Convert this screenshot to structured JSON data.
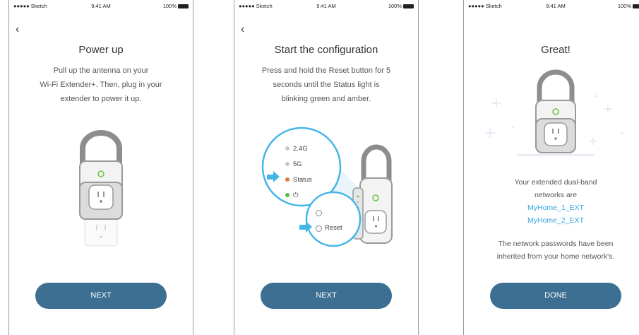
{
  "status_bar": {
    "carrier": "●●●●● Sketch",
    "time": "9:41 AM",
    "battery": "100%"
  },
  "screen1": {
    "back_icon": "‹",
    "title": "Power up",
    "description": [
      "Pull up the antenna on your",
      "Wi-Fi Extender+. Then, plug in your",
      "extender to power it up."
    ],
    "button": "NEXT"
  },
  "screen2": {
    "back_icon": "‹",
    "title": "Start the configuration",
    "description": [
      "Press and hold the Reset button for 5",
      "seconds until the Status light is",
      "blinking green and amber."
    ],
    "leds": [
      {
        "label": "2.4G",
        "color": "#c8c8c8"
      },
      {
        "label": "5G",
        "color": "#c8c8c8"
      },
      {
        "label": "Status",
        "color": "#e07a3a"
      },
      {
        "label": "⏻",
        "color": "#5dbb3a"
      }
    ],
    "reset_label": "Reset",
    "button": "NEXT"
  },
  "screen3": {
    "title": "Great!",
    "message_lines": [
      "Your extended dual-band",
      "networks are"
    ],
    "networks": [
      "MyHome_1_EXT",
      "MyHome_2_EXT"
    ],
    "note_lines": [
      "The network passwords have been",
      "inherited from your home network's."
    ],
    "button": "DONE"
  },
  "colors": {
    "button": "#3d6f93",
    "link": "#36a6e0",
    "accent_arrow": "#44b6e6",
    "led_green": "#5dbb3a",
    "led_amber": "#e07a3a"
  }
}
